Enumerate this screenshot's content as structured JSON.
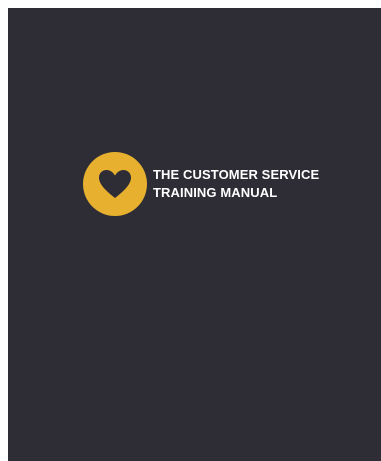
{
  "document": {
    "title_line_1": "THE CUSTOMER SERVICE",
    "title_line_2": "TRAINING MANUAL"
  },
  "logo": {
    "icon": "heart-icon",
    "badge_color": "#e7b12f",
    "icon_color": "#2e2d36"
  },
  "colors": {
    "cover_background": "#2e2d36",
    "title_text": "#ffffff",
    "page_background": "#ffffff"
  }
}
